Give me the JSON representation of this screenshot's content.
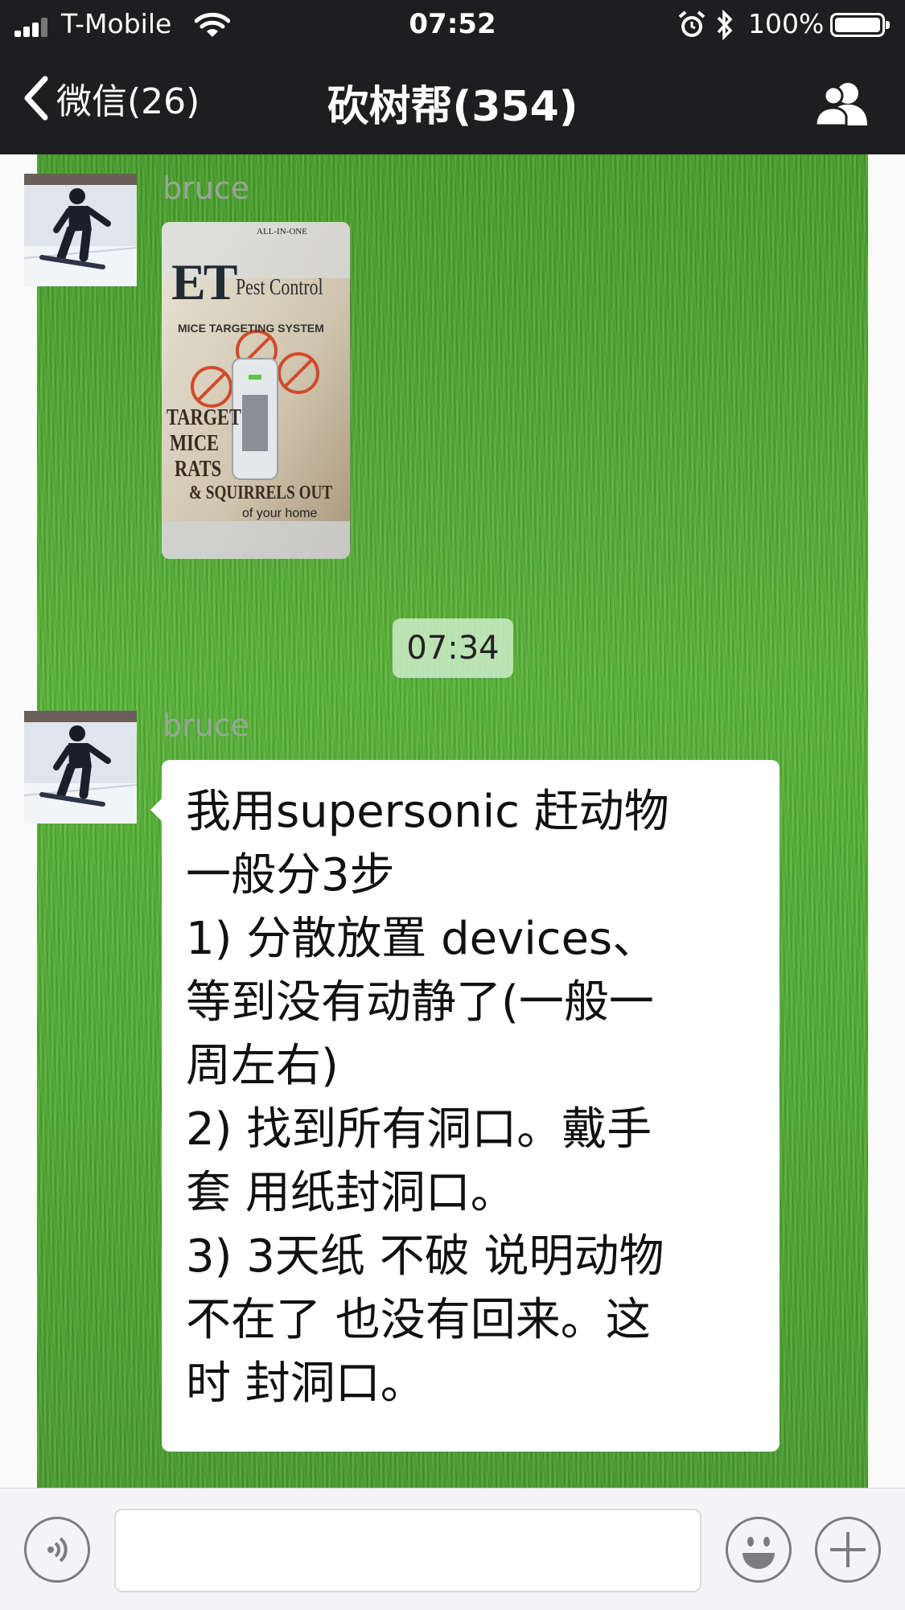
{
  "status_bar": {
    "carrier": "T-Mobile",
    "time": "07:52",
    "battery_percent": "100%",
    "icons": [
      "signal-icon",
      "wifi-icon",
      "alarm-icon",
      "bluetooth-icon",
      "battery-icon"
    ]
  },
  "nav": {
    "back_label": "微信(26)",
    "title": "砍树帮(354)",
    "icons": [
      "chevron-left-icon",
      "group-members-icon"
    ]
  },
  "messages": [
    {
      "type": "image",
      "sender": "bruce",
      "image_text": {
        "brand_small": "ALL-IN-ONE",
        "logo": "ET",
        "product": "Pest Control",
        "subtitle": "MICE TARGETING SYSTEM",
        "target_lines": [
          "TARGET",
          "MICE",
          "RATS",
          "& SQUIRRELS OUT"
        ],
        "footer": "of your home"
      }
    },
    {
      "type": "timestamp",
      "time": "07:34"
    },
    {
      "type": "text",
      "sender": "bruce",
      "lines": [
        "我用supersonic 赶动物",
        "一般分3步",
        "1) 分散放置 devices、",
        "等到没有动静了(一般一",
        "周左右)",
        "2) 找到所有洞口。戴手",
        "套 用纸封洞口。",
        "3) 3天纸 不破 说明动物",
        "不在了 也没有回来。这",
        "时 封洞口。"
      ]
    }
  ],
  "input_bar": {
    "icons": [
      "voice-icon",
      "emoji-icon",
      "plus-icon"
    ],
    "placeholder": ""
  },
  "colors": {
    "nav_background": "#1e1e20",
    "grass_background": "#52ad34",
    "bubble_background": "#ffffff",
    "input_bar_background": "#f4f4f6"
  }
}
